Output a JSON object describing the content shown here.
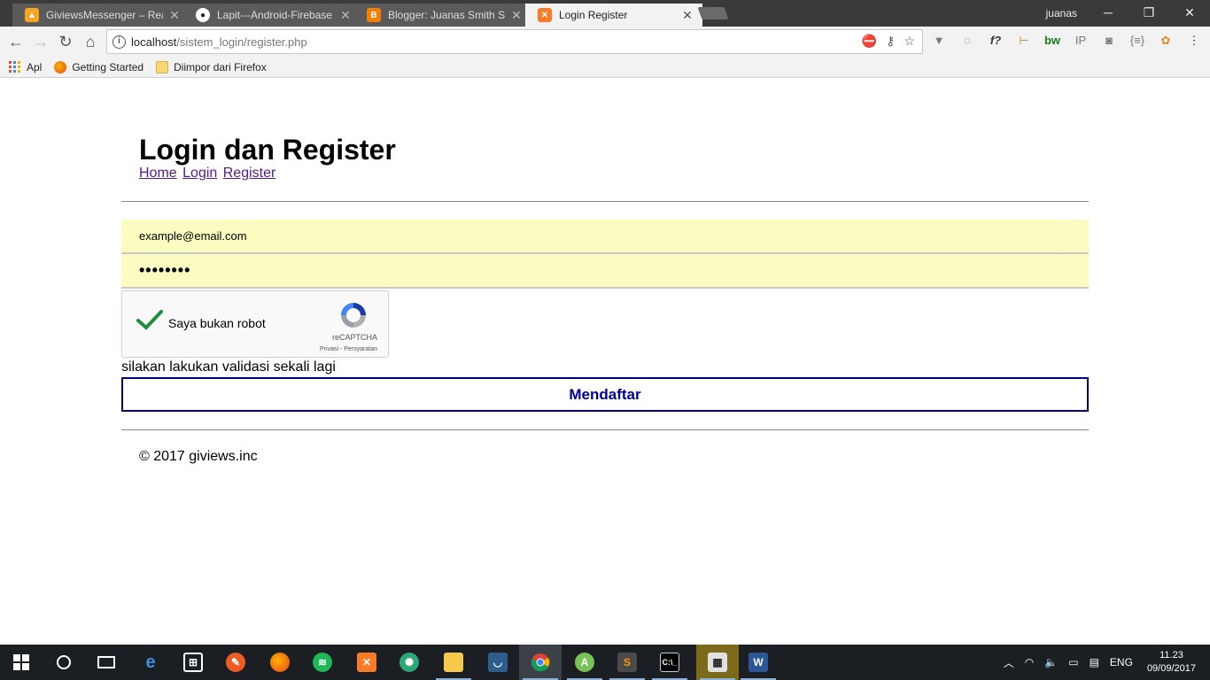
{
  "browser": {
    "tabs": [
      {
        "title": "GiviewsMessenger – Real",
        "icon": "firebase-icon",
        "color": "#f5a623"
      },
      {
        "title": "Lapit---Android-Firebase",
        "icon": "github-icon",
        "color": "#222222"
      },
      {
        "title": "Blogger: Juanas Smith Sh",
        "icon": "blogger-icon",
        "color": "#f57d00"
      },
      {
        "title": "Login Register",
        "icon": "xampp-icon",
        "color": "#fb7a24"
      }
    ],
    "active_tab_index": 3,
    "user": "juanas",
    "address": {
      "host": "localhost",
      "path": "/sistem_login/register.php"
    },
    "bookmarks": [
      {
        "label": "Apl",
        "icon": "apps-icon"
      },
      {
        "label": "Getting Started",
        "icon": "firefox-icon"
      },
      {
        "label": "Diimpor dari Firefox",
        "icon": "folder-icon"
      }
    ]
  },
  "page": {
    "title": "Login dan Register",
    "nav": {
      "home": "Home",
      "login": "Login",
      "register": "Register"
    },
    "email_value": "example@email.com",
    "password_mask": "••••••••",
    "captcha": {
      "label": "Saya bukan robot",
      "brand": "reCAPTCHA",
      "links": "Privasi - Persyaratan",
      "checked": true
    },
    "validation_message": "silakan lakukan validasi sekali lagi",
    "submit_label": "Mendaftar",
    "footer": "© 2017 giviews.inc"
  },
  "taskbar": {
    "language": "ENG",
    "time": "11.23",
    "date": "09/09/2017"
  }
}
